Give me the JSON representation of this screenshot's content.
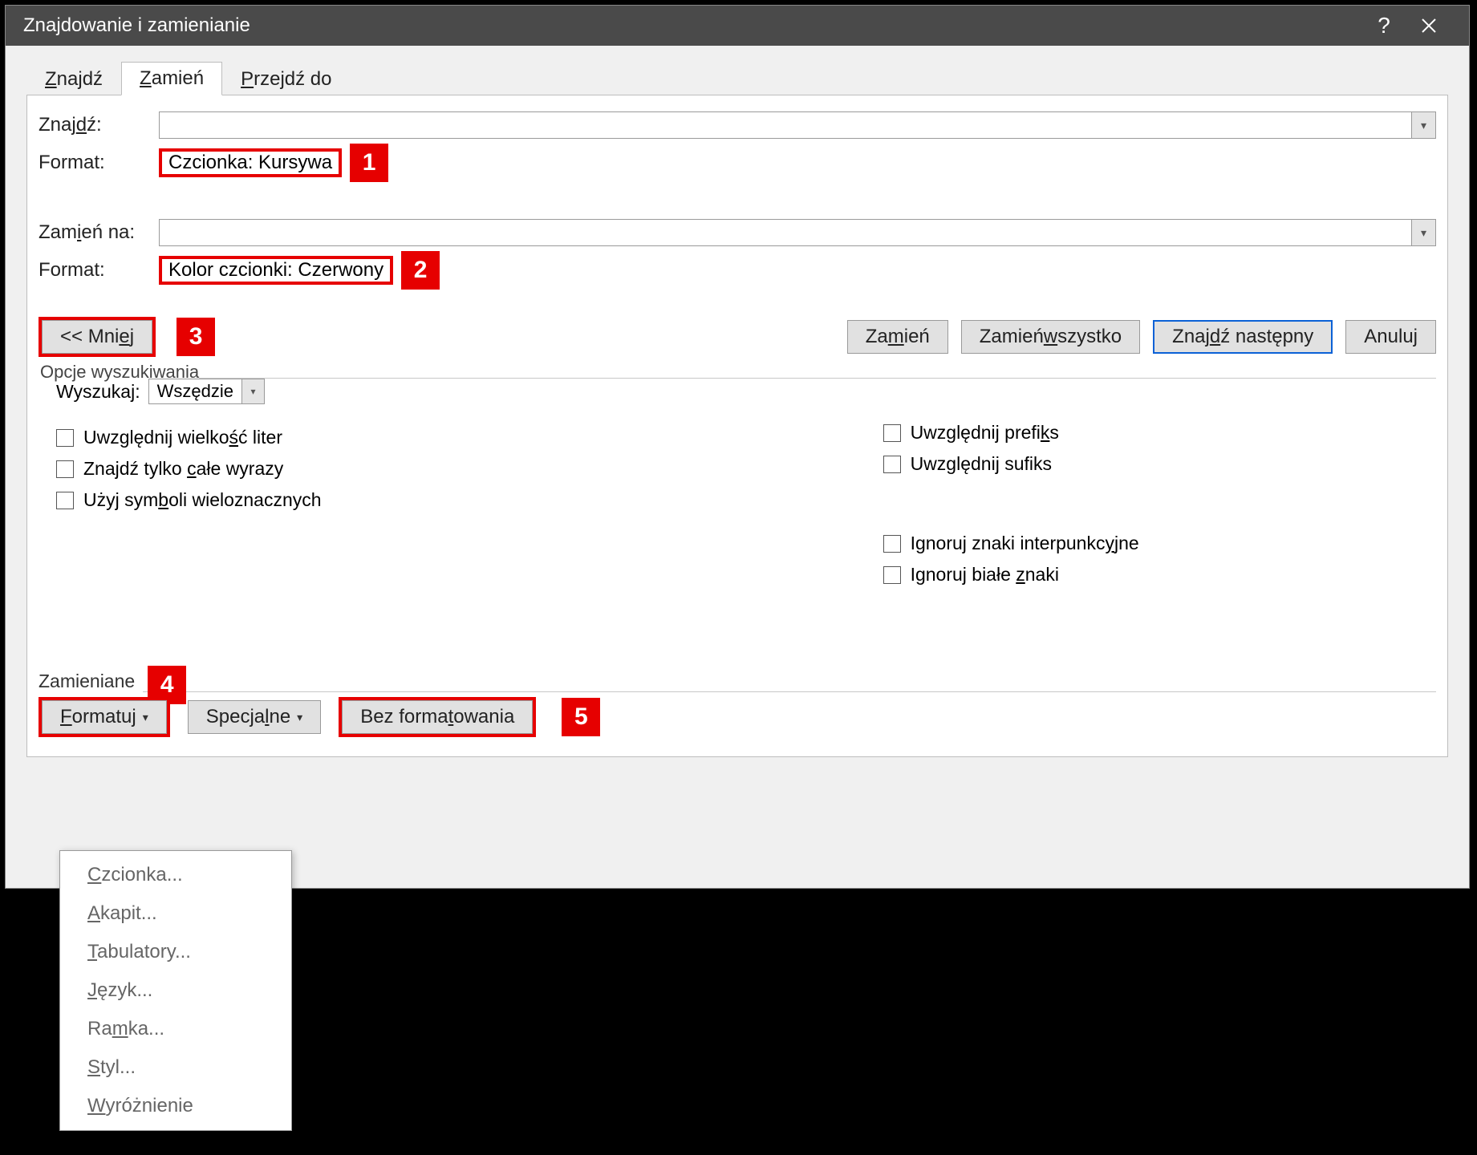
{
  "title": "Znajdowanie i zamienianie",
  "tabs": {
    "find": "Znajdź",
    "replace": "Zamień",
    "goto": "Przejdź do"
  },
  "find": {
    "label": "Znajdź:",
    "format_label": "Format:",
    "format_value": "Czcionka: Kursywa"
  },
  "replace": {
    "label": "Zamień na:",
    "format_label": "Format:",
    "format_value": "Kolor czcionki: Czerwony"
  },
  "buttons": {
    "less": "<< Mniej",
    "replace_one": "Zamień",
    "replace_all": "Zamień wszystko",
    "find_next": "Znajdź następny",
    "cancel": "Anuluj"
  },
  "search_opts": {
    "group": "Opcje wyszukiwania",
    "search_label": "Wyszukaj:",
    "search_value": "Wszędzie",
    "match_case": "Uwzględnij wielkość liter",
    "whole_words": "Znajdź tylko całe wyrazy",
    "wildcards": "Użyj symboli wieloznacznych",
    "prefix": "Uwzględnij prefiks",
    "suffix": "Uwzględnij sufiks",
    "ignore_punct": "Ignoruj znaki interpunkcyjne",
    "ignore_ws": "Ignoruj białe znaki"
  },
  "bottom": {
    "group": "Zamieniane",
    "format_btn": "Formatuj",
    "special_btn": "Specjalne",
    "noformat_btn": "Bez formatowania"
  },
  "format_menu": {
    "font": "Czcionka...",
    "para": "Akapit...",
    "tabs": "Tabulatory...",
    "lang": "Język...",
    "frame": "Ramka...",
    "style": "Styl...",
    "highlight": "Wyróżnienie"
  },
  "callouts": {
    "c1": "1",
    "c2": "2",
    "c3": "3",
    "c4": "4",
    "c5": "5"
  }
}
